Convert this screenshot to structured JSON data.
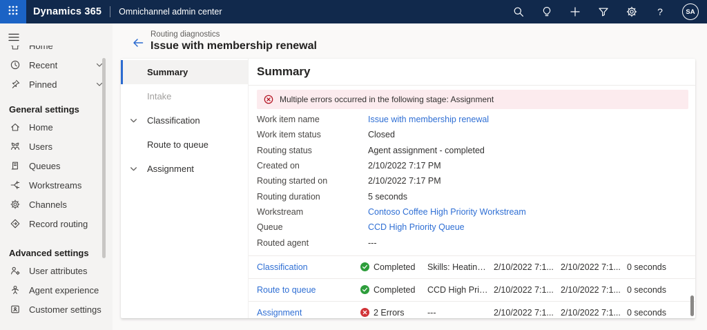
{
  "topbar": {
    "brand": "Dynamics 365",
    "app_name": "Omnichannel admin center",
    "icons": [
      "app-launcher",
      "search",
      "lightbulb",
      "add",
      "filter",
      "settings",
      "help"
    ],
    "help_label": "?",
    "avatar_initials": "SA"
  },
  "sidebar": {
    "clipped_item": {
      "label": "Home",
      "icon": "home-icon"
    },
    "top_items": [
      {
        "label": "Recent",
        "icon": "clock-icon",
        "chevron": true
      },
      {
        "label": "Pinned",
        "icon": "pin-icon",
        "chevron": true
      }
    ],
    "sections": [
      {
        "header": "General settings",
        "items": [
          {
            "label": "Home",
            "icon": "home-icon"
          },
          {
            "label": "Users",
            "icon": "users-icon"
          },
          {
            "label": "Queues",
            "icon": "queues-icon"
          },
          {
            "label": "Workstreams",
            "icon": "workstreams-icon"
          },
          {
            "label": "Channels",
            "icon": "gear-icon"
          },
          {
            "label": "Record routing",
            "icon": "record-routing-icon"
          }
        ]
      },
      {
        "header": "Advanced settings",
        "items": [
          {
            "label": "User attributes",
            "icon": "user-attributes-icon"
          },
          {
            "label": "Agent experience",
            "icon": "agent-experience-icon"
          },
          {
            "label": "Customer settings",
            "icon": "customer-settings-icon"
          }
        ]
      }
    ]
  },
  "page_header": {
    "breadcrumb": "Routing diagnostics",
    "title": "Issue with membership renewal"
  },
  "stage_nav": {
    "items": [
      {
        "label": "Summary",
        "state": "selected"
      },
      {
        "label": "Intake",
        "state": "disabled"
      },
      {
        "label": "Classification",
        "state": "expandable"
      },
      {
        "label": "Route to queue",
        "state": "child"
      },
      {
        "label": "Assignment",
        "state": "expandable"
      }
    ]
  },
  "main": {
    "heading": "Summary",
    "error_banner": "Multiple errors occurred in the following stage: Assignment",
    "fields": [
      {
        "label": "Work item name",
        "value": "Issue with membership renewal"
      },
      {
        "label": "Work item status",
        "value": "Closed"
      },
      {
        "label": "Routing status",
        "value": "Agent assignment - completed"
      },
      {
        "label": "Created on",
        "value": "2/10/2022 7:17 PM"
      },
      {
        "label": "Routing started on",
        "value": "2/10/2022 7:17 PM"
      },
      {
        "label": "Routing duration",
        "value": "5 seconds"
      },
      {
        "label": "Workstream",
        "value": "Contoso Coffee High Priority Workstream"
      },
      {
        "label": "Queue",
        "value": "CCD High Priority Queue"
      },
      {
        "label": "Routed agent",
        "value": "---"
      }
    ],
    "stages": [
      {
        "stage": "Classification",
        "status": "Completed",
        "status_kind": "success",
        "detail": "Skills: Heating,...",
        "started": "2/10/2022 7:1...",
        "ended": "2/10/2022 7:1...",
        "duration": "0 seconds"
      },
      {
        "stage": "Route to queue",
        "status": "Completed",
        "status_kind": "success",
        "detail": "CCD High Prio...",
        "started": "2/10/2022 7:1...",
        "ended": "2/10/2022 7:1...",
        "duration": "0 seconds"
      },
      {
        "stage": "Assignment",
        "status": "2 Errors",
        "status_kind": "error",
        "detail": "---",
        "started": "2/10/2022 7:1...",
        "ended": "2/10/2022 7:1...",
        "duration": "0 seconds"
      }
    ]
  },
  "colors": {
    "topbar_bg": "#11294C",
    "waffle_bg": "#1B63C5",
    "accent_link": "#2F6FD4",
    "selected_bar": "#2B6BD0",
    "error_banner_bg": "#FCEBEE",
    "error_icon": "#B10E1C",
    "success_green": "#2D9D3B",
    "error_red": "#D13438",
    "page_bg": "#FAF9F8",
    "sidebar_bg": "#F4F3F2"
  }
}
